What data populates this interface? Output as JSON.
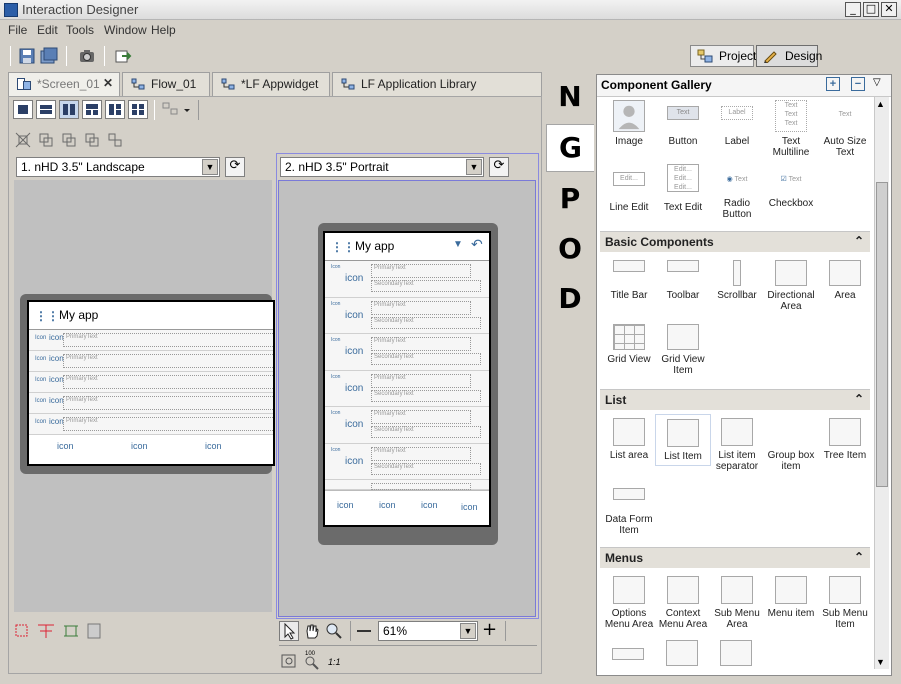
{
  "window": {
    "title": "Interaction Designer",
    "minimize": "_",
    "maximize": "□",
    "close": "✕"
  },
  "menu": [
    "File",
    "Edit",
    "Tools",
    "Window",
    "Help"
  ],
  "perspectives": {
    "project": "Project",
    "design": "Design"
  },
  "tabs": [
    "*Screen_01",
    "Flow_01",
    "*LF Appwidget",
    "LF Application Library"
  ],
  "tab_close": "✕",
  "left_view": {
    "resolution": "1. nHD 3.5\" Landscape"
  },
  "right_view": {
    "resolution": "2. nHD 3.5\" Portrait"
  },
  "device": {
    "app_title": "My app",
    "primary": "PrimaryText",
    "secondary": "SecondaryText",
    "icon": "icon",
    "icon_small": "Icon"
  },
  "zoom": {
    "value": "61%",
    "scale_label": "1:1",
    "ratio_label": "100"
  },
  "letters": [
    "N",
    "G",
    "P",
    "O",
    "D"
  ],
  "gallery": {
    "title": "Component Gallery",
    "add": "+",
    "remove": "−",
    "collapse": "⌃",
    "top_items": [
      "Image",
      "Button",
      "Label",
      "Text Multiline",
      "Auto Size Text",
      "Line Edit",
      "Text Edit",
      "Radio Button",
      "Checkbox"
    ],
    "samples": {
      "button": "Text",
      "label": "Label",
      "textml": "Text",
      "edit": "Edit..."
    },
    "sections": [
      {
        "title": "Basic Components",
        "items": [
          "Title Bar",
          "Toolbar",
          "Scrollbar",
          "Directional Area",
          "Area",
          "Grid View",
          "Grid View Item"
        ]
      },
      {
        "title": "List",
        "items": [
          "List area",
          "List Item",
          "List item separator",
          "Group box item",
          "Tree Item",
          "Data Form Item"
        ]
      },
      {
        "title": "Menus",
        "items": [
          "Options Menu Area",
          "Context Menu Area",
          "Sub Menu Area",
          "Menu item",
          "Sub Menu Item"
        ]
      }
    ]
  }
}
